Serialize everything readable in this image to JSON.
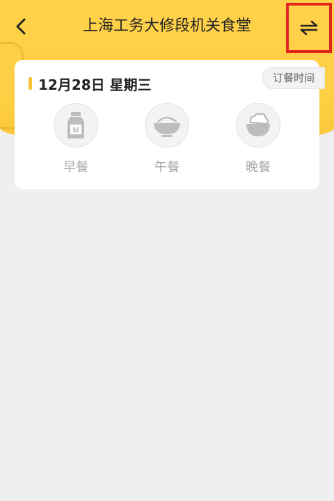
{
  "header": {
    "title": "上海工务大修段机关食堂",
    "back_icon": "chevron-left-icon",
    "switch_icon": "swap-arrows-icon",
    "accent_color": "#ffd24a",
    "highlight_color": "#e2261f"
  },
  "card": {
    "order_time_label": "订餐时间",
    "date": "12月28日 星期三",
    "meals": [
      {
        "label": "早餐",
        "icon": "milk-bottle-icon"
      },
      {
        "label": "午餐",
        "icon": "rice-bowl-icon"
      },
      {
        "label": "晚餐",
        "icon": "salad-bowl-icon"
      }
    ]
  }
}
